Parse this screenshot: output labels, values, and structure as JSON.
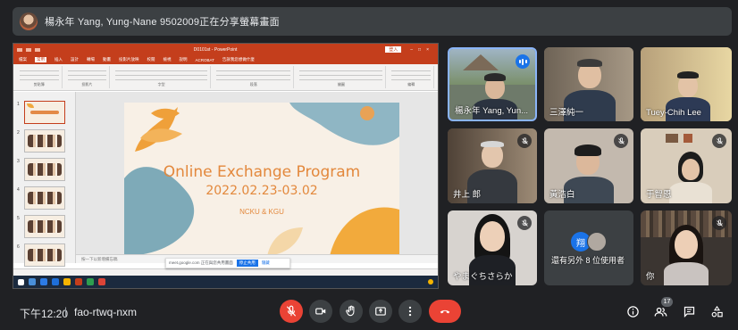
{
  "banner": {
    "text": "楊永年 Yang, Yung-Nane 9502009正在分享螢幕畫面"
  },
  "presentation": {
    "app_title": "D0101st - PowerPoint",
    "signin": "登入",
    "menu": [
      "檔案",
      "常用",
      "插入",
      "設計",
      "轉場",
      "動畫",
      "投影片放映",
      "校閱",
      "檢視",
      "說明",
      "ACROBAT",
      "告訴我您想做什麼"
    ],
    "ribbon_groups": [
      "剪貼簿",
      "投影片",
      "字型",
      "段落",
      "繪圖",
      "編輯"
    ],
    "slide_title": "Online Exchange Program",
    "slide_dates": "2022.02.23-03.02",
    "slide_sub": "NCKU & KGU",
    "notes": "按一下以新增備忘稿",
    "thumb_numbers": [
      "1",
      "2",
      "3",
      "4",
      "5",
      "6"
    ],
    "meet_banner": {
      "text": "meet.google.com 正在與您共用畫面",
      "stop": "停止共用",
      "hide": "隱藏"
    }
  },
  "participants": [
    {
      "name": "楊永年 Yang, Yun...",
      "speaking": true
    },
    {
      "name": "三澤純一",
      "muted": false
    },
    {
      "name": "Tuey-Chih Lee",
      "muted": false
    },
    {
      "name": "井上 郎",
      "muted": true
    },
    {
      "name": "黃浩白",
      "muted": true
    },
    {
      "name": "于智恩",
      "muted": true
    },
    {
      "name": "やまぐちさらか",
      "muted": true
    },
    {
      "name": "還有另外 8 位使用者",
      "initial": "翔"
    },
    {
      "name": "你",
      "muted": true
    }
  ],
  "bottom": {
    "time": "下午12:20",
    "separator": "|",
    "meeting_code": "fao-rtwq-nxm",
    "people_count": "17"
  },
  "icons": [
    "mic-off-icon",
    "camera-icon",
    "raise-hand-icon",
    "present-icon",
    "more-icon",
    "end-call-icon",
    "info-icon",
    "people-icon",
    "chat-icon",
    "activities-icon"
  ],
  "colors": {
    "accent": "#8ab4f8",
    "danger": "#ea4335",
    "ppt": "#c43e1c",
    "slide_text": "#e3883c"
  }
}
